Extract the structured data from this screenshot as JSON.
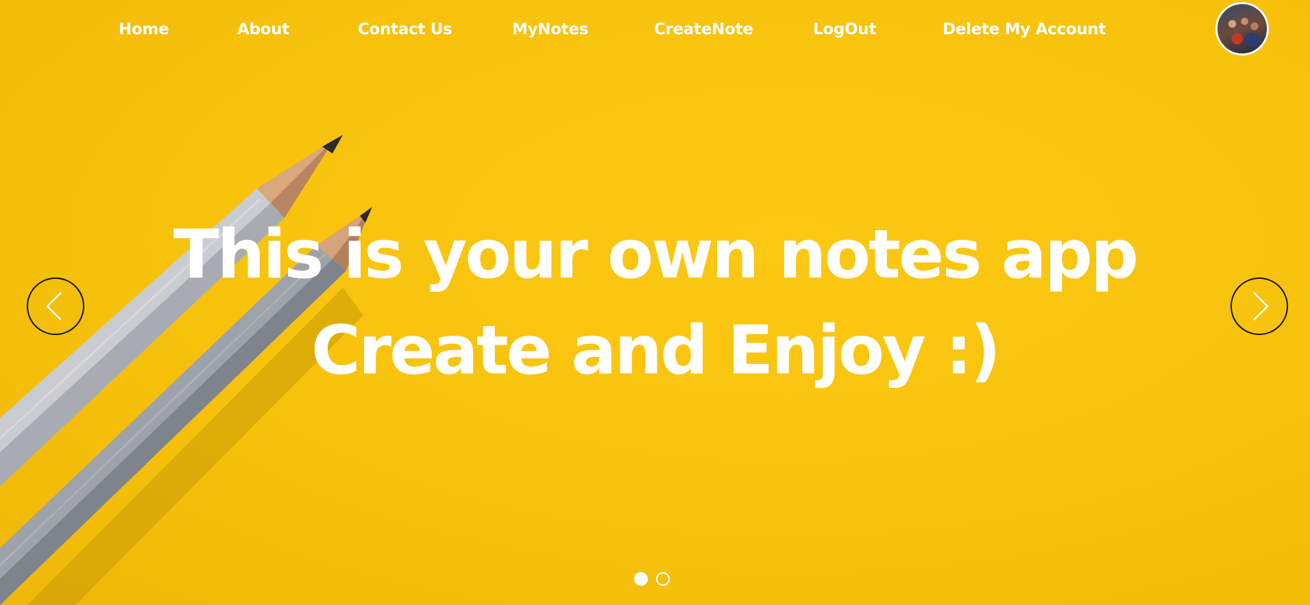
{
  "nav": {
    "items": [
      {
        "label": "Home"
      },
      {
        "label": "About"
      },
      {
        "label": "Contact Us"
      },
      {
        "label": "MyNotes"
      },
      {
        "label": "CreateNote"
      },
      {
        "label": "LogOut"
      },
      {
        "label": "Delete My Account"
      }
    ],
    "avatar_icon": "user-avatar"
  },
  "hero": {
    "line1": "This is your own notes app",
    "line2": "Create and Enjoy :)",
    "background_color": "#f7c20c",
    "text_color": "#ffffff"
  },
  "carousel": {
    "prev_icon": "chevron-left-icon",
    "next_icon": "chevron-right-icon",
    "slide_count": 2,
    "active_slide": 1
  }
}
